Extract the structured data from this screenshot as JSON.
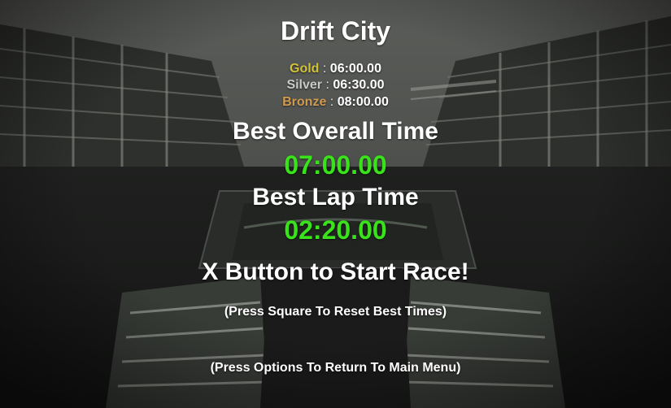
{
  "track_name": "Drift City",
  "medals": {
    "gold": {
      "label": "Gold",
      "separator": " : ",
      "time": "06:00.00",
      "color": "#d4c236"
    },
    "silver": {
      "label": "Silver",
      "separator": " : ",
      "time": "06:30.00",
      "color": "#c9c9c9"
    },
    "bronze": {
      "label": "Bronze",
      "separator": " : ",
      "time": "08:00.00",
      "color": "#d29a4e"
    }
  },
  "best_overall": {
    "label": "Best Overall Time",
    "time": "07:00.00"
  },
  "best_lap": {
    "label": "Best Lap Time",
    "time": "02:20.00"
  },
  "start_prompt": "X Button to Start Race!",
  "reset_hint": "(Press Square To Reset Best Times)",
  "menu_hint": "(Press Options To Return To Main Menu)",
  "colors": {
    "time_green": "#39e31a",
    "text_white": "#ffffff"
  }
}
